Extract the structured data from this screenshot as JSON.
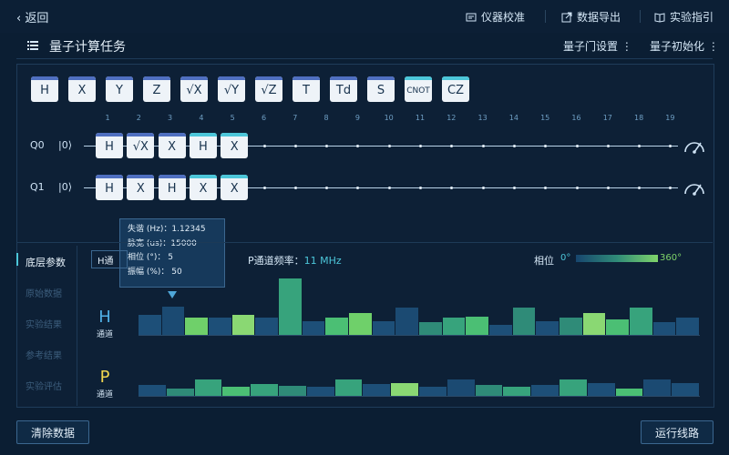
{
  "topbar": {
    "back_label": "返回",
    "links": [
      {
        "label": "仪器校准",
        "icon": "calibration-icon"
      },
      {
        "label": "数据导出",
        "icon": "export-icon"
      },
      {
        "label": "实验指引",
        "icon": "book-icon"
      }
    ]
  },
  "task": {
    "title": "量子计算任务",
    "gate_settings": "量子门设置",
    "qubit_init": "量子初始化"
  },
  "gate_palette": [
    {
      "label": "H",
      "style": "blue"
    },
    {
      "label": "X",
      "style": "blue"
    },
    {
      "label": "Y",
      "style": "blue"
    },
    {
      "label": "Z",
      "style": "blue"
    },
    {
      "label": "√X",
      "style": "blue"
    },
    {
      "label": "√Y",
      "style": "blue"
    },
    {
      "label": "√Z",
      "style": "blue"
    },
    {
      "label": "T",
      "style": "blue"
    },
    {
      "label": "Td",
      "style": "blue"
    },
    {
      "label": "S",
      "style": "blue"
    },
    {
      "label": "CNOT",
      "style": "cyan"
    },
    {
      "label": "CZ",
      "style": "cyan"
    }
  ],
  "columns": [
    "1",
    "2",
    "3",
    "4",
    "5",
    "6",
    "7",
    "8",
    "9",
    "10",
    "11",
    "12",
    "13",
    "14",
    "15",
    "16",
    "17",
    "18",
    "19"
  ],
  "qubits": [
    {
      "label": "Q0",
      "state": "|0⟩",
      "gates": [
        {
          "label": "H",
          "style": "blue"
        },
        {
          "label": "√X",
          "style": "blue"
        },
        {
          "label": "X",
          "style": "blue"
        },
        {
          "label": "H",
          "style": "cyan"
        },
        {
          "label": "X",
          "style": "cyan"
        }
      ]
    },
    {
      "label": "Q1",
      "state": "|0⟩",
      "gates": [
        {
          "label": "H",
          "style": "blue"
        },
        {
          "label": "X",
          "style": "blue"
        },
        {
          "label": "H",
          "style": "blue"
        },
        {
          "label": "X",
          "style": "cyan"
        },
        {
          "label": "X",
          "style": "cyan"
        }
      ]
    }
  ],
  "tooltip": {
    "detune": "失谐 (Hz)：1.12345",
    "pulse_width": "脉宽 (us)：15000",
    "phase": "相位 (°)：  5",
    "amplitude": "振幅 (%)：  50"
  },
  "sidebar": {
    "items": [
      {
        "label": "底层参数",
        "active": true
      },
      {
        "label": "原始数据",
        "active": false
      },
      {
        "label": "实验结果",
        "active": false
      },
      {
        "label": "参考结果",
        "active": false
      },
      {
        "label": "实验评估",
        "active": false
      }
    ]
  },
  "params": {
    "channel_select": "H通",
    "freq_label": "P通道频率：",
    "freq_value": "11 MHz",
    "phase_label": "相位",
    "phase_min": "0°",
    "phase_max": "360°"
  },
  "channels": [
    {
      "letter": "H",
      "name": "通道",
      "color": "#4fb0e6",
      "bars": [
        {
          "h": 0.35,
          "c": "#1d4f78"
        },
        {
          "h": 0.5,
          "c": "#1b4a72"
        },
        {
          "h": 0.3,
          "c": "#6fd06a"
        },
        {
          "h": 0.3,
          "c": "#1d4f78"
        },
        {
          "h": 0.35,
          "c": "#8ad873"
        },
        {
          "h": 0.3,
          "c": "#1d4f78"
        },
        {
          "h": 1.0,
          "c": "#37a37c"
        },
        {
          "h": 0.25,
          "c": "#1d4f78"
        },
        {
          "h": 0.3,
          "c": "#4bbf74"
        },
        {
          "h": 0.38,
          "c": "#6fd06a"
        },
        {
          "h": 0.25,
          "c": "#1d4f78"
        },
        {
          "h": 0.48,
          "c": "#1b4a72"
        },
        {
          "h": 0.22,
          "c": "#2f8b78"
        },
        {
          "h": 0.3,
          "c": "#37a37c"
        },
        {
          "h": 0.33,
          "c": "#4bbf74"
        },
        {
          "h": 0.18,
          "c": "#1d4f78"
        },
        {
          "h": 0.48,
          "c": "#2f8b78"
        },
        {
          "h": 0.25,
          "c": "#1d4f78"
        },
        {
          "h": 0.3,
          "c": "#2f8b78"
        },
        {
          "h": 0.38,
          "c": "#8ad873"
        },
        {
          "h": 0.28,
          "c": "#4bbf74"
        },
        {
          "h": 0.48,
          "c": "#37a37c"
        },
        {
          "h": 0.22,
          "c": "#1d4f78"
        },
        {
          "h": 0.3,
          "c": "#1d4f78"
        }
      ]
    },
    {
      "letter": "P",
      "name": "通道",
      "color": "#f0d650",
      "bars": [
        {
          "h": 0.35,
          "c": "#1d4f78"
        },
        {
          "h": 0.25,
          "c": "#2f8b78"
        },
        {
          "h": 0.55,
          "c": "#37a37c"
        },
        {
          "h": 0.3,
          "c": "#4bbf74"
        },
        {
          "h": 0.4,
          "c": "#37a37c"
        },
        {
          "h": 0.33,
          "c": "#2f8b78"
        },
        {
          "h": 0.3,
          "c": "#1d4f78"
        },
        {
          "h": 0.55,
          "c": "#37a37c"
        },
        {
          "h": 0.4,
          "c": "#1d4f78"
        },
        {
          "h": 0.42,
          "c": "#8ad873"
        },
        {
          "h": 0.3,
          "c": "#1d4f78"
        },
        {
          "h": 0.55,
          "c": "#1b4a72"
        },
        {
          "h": 0.36,
          "c": "#2f8b78"
        },
        {
          "h": 0.3,
          "c": "#37a37c"
        },
        {
          "h": 0.36,
          "c": "#1d4f78"
        },
        {
          "h": 0.55,
          "c": "#37a37c"
        },
        {
          "h": 0.42,
          "c": "#1d4f78"
        },
        {
          "h": 0.25,
          "c": "#4bbf74"
        },
        {
          "h": 0.55,
          "c": "#1b4a72"
        },
        {
          "h": 0.42,
          "c": "#1d4f78"
        }
      ]
    }
  ],
  "buttons": {
    "clear": "清除数据",
    "run": "运行线路"
  }
}
